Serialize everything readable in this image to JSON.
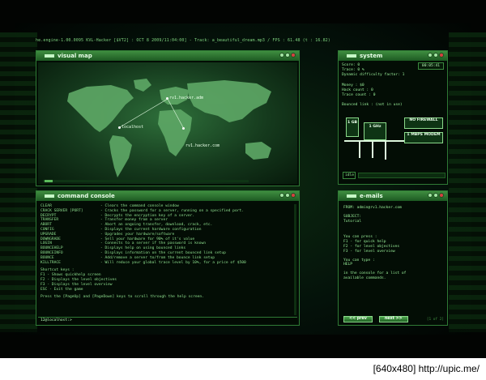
{
  "statusline": "he.engine-1.00.0095 KVL-Hacker [$VT2] : OCT  8 2009/11:04:00] - Track: a_beautiful_dream.mp3 / FPS : 61.48 (t : 16.82)",
  "map": {
    "title": "visual map",
    "nodes": [
      {
        "label": "localhost"
      },
      {
        "label": "rv1.hacker.adm"
      },
      {
        "label": "rv1.hacker.com"
      }
    ],
    "colors": {
      "land": "#5ea866",
      "sea": "#1a4a22"
    }
  },
  "system": {
    "title": "system",
    "time": "00:05:41",
    "rows": [
      "Score: 0",
      "Trace: 0 %",
      "Dynamic difficulty factor: 1",
      "",
      "Money      :  $0",
      "Hack count  :  0",
      "Trace count :  0",
      "",
      "Bounced link : (not in use)"
    ],
    "hw": {
      "ram": "1 GB",
      "cpu": "1 GHz",
      "firewall": "NO FIREWALL",
      "modem": "1 MBPS MODEM"
    },
    "idle": "idle"
  },
  "console": {
    "title": "command console",
    "commands": [
      {
        "c": "CLEAR",
        "d": "- Clears the command console window"
      },
      {
        "c": "CRACK SERVER [PORT]",
        "d": "- Cracks the password for a server, running on a specified port."
      },
      {
        "c": "DECRYPT",
        "d": "- Decrypts the encryption key of a server."
      },
      {
        "c": "TRANSFER",
        "d": "- Transfer money from a server"
      },
      {
        "c": "ABORT",
        "d": "- Abort an ongoing transfer, download, crack, etc."
      },
      {
        "c": "CONFIG",
        "d": "- Displays the current hardware configuration"
      },
      {
        "c": "UPGRADE",
        "d": "- Upgrades your hardware/software"
      },
      {
        "c": "DOWNGRADE",
        "d": "- Sell your hardware for 90% of it's value"
      },
      {
        "c": "LOGIN",
        "d": "- Connects to a server if the password is known"
      },
      {
        "c": "BOUNCEHELP",
        "d": "- Displays help on using bounced links"
      },
      {
        "c": "BOUNCEINFO",
        "d": "- Displays information on the current bounced link setup"
      },
      {
        "c": "BOUNCE",
        "d": "- Add/remove a server to/from the bounce link setup"
      },
      {
        "c": "KILLTRACE",
        "d": "- Will reduce your global trace level by 10%, for a price of $500"
      }
    ],
    "shortcut_header": "Shortcut keys :",
    "shortcuts": [
      "F1 - Shows quickhelp screen",
      "F2 - Displays the level objectives",
      "F3 - Displays the level overview",
      "ESC - Exit the game"
    ],
    "scroll_hint": "Press the [PageUp] and [PageDown] keys to scroll through the help screen.",
    "prompt": "12@localhost:>"
  },
  "emails": {
    "title": "e-mails",
    "from": "FROM: admin@rv1.hacker.com",
    "subject_label": "SUBJECT:",
    "subject": "Tutorial",
    "body": [
      "You can press :",
      "F1 - for quick help",
      "F2 - for level objectives",
      "F3 - for level overview",
      "",
      "You can type :",
      "HELP",
      "",
      "in the console for a list of",
      "available commands."
    ],
    "prev": "<< prev",
    "next": "next >>",
    "page": "[1 of 2]"
  },
  "watermark": "[640x480] http://upic.me/"
}
